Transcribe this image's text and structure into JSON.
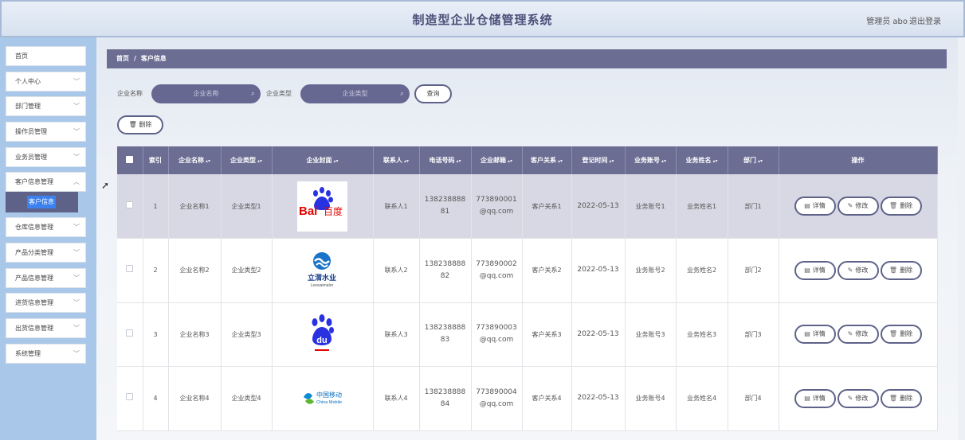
{
  "header": {
    "title": "制造型企业仓储管理系统",
    "admin": "管理员 abo",
    "logout": "退出登录"
  },
  "sidebar": {
    "items": [
      {
        "label": "首页",
        "chevron": false
      },
      {
        "label": "个人中心",
        "chevron": true
      },
      {
        "label": "部门管理",
        "chevron": true
      },
      {
        "label": "操作员管理",
        "chevron": true
      },
      {
        "label": "业务员管理",
        "chevron": true
      },
      {
        "label": "客户信息管理",
        "chevron": true
      },
      {
        "label": "仓库信息管理",
        "chevron": true
      },
      {
        "label": "产品分类管理",
        "chevron": true
      },
      {
        "label": "产品信息管理",
        "chevron": true
      },
      {
        "label": "进货信息管理",
        "chevron": true
      },
      {
        "label": "出货信息管理",
        "chevron": true
      },
      {
        "label": "系统管理",
        "chevron": true
      }
    ],
    "sub_item": "客户信息"
  },
  "breadcrumb": {
    "home": "首页",
    "sep": "/",
    "current": "客户信息"
  },
  "search": {
    "company_label": "企业名称",
    "company_placeholder": "企业名称",
    "type_label": "企业类型",
    "type_placeholder": "企业类型",
    "query_button": "查询",
    "delete_button": "删除"
  },
  "table": {
    "headers": [
      "索引",
      "企业名称",
      "企业类型",
      "企业封面",
      "联系人",
      "电话号码",
      "企业邮箱",
      "客户关系",
      "登记时间",
      "业务账号",
      "业务姓名",
      "部门",
      "操作"
    ],
    "actions": {
      "detail": "详情",
      "edit": "修改",
      "delete": "删除"
    },
    "rows": [
      {
        "index": "1",
        "name": "企业名称1",
        "type": "企业类型1",
        "cover": "baidu-logo",
        "contact": "联系人1",
        "tel_a": "138238888",
        "tel_b": "81",
        "mail_a": "773890001",
        "mail_b": "@qq.com",
        "relation": "客户关系1",
        "date": "2022-05-13",
        "account": "业务账号1",
        "staff": "业务姓名1",
        "dept": "部门1"
      },
      {
        "index": "2",
        "name": "企业名称2",
        "type": "企业类型2",
        "cover": "liwei-logo",
        "contact": "联系人2",
        "tel_a": "138238888",
        "tel_b": "82",
        "mail_a": "773890002",
        "mail_b": "@qq.com",
        "relation": "客户关系2",
        "date": "2022-05-13",
        "account": "业务账号2",
        "staff": "业务姓名2",
        "dept": "部门2"
      },
      {
        "index": "3",
        "name": "企业名称3",
        "type": "企业类型3",
        "cover": "du-paw-logo",
        "contact": "联系人3",
        "tel_a": "138238888",
        "tel_b": "83",
        "mail_a": "773890003",
        "mail_b": "@qq.com",
        "relation": "客户关系3",
        "date": "2022-05-13",
        "account": "业务账号3",
        "staff": "业务姓名3",
        "dept": "部门3"
      },
      {
        "index": "4",
        "name": "企业名称4",
        "type": "企业类型4",
        "cover": "china-mobile-logo",
        "contact": "联系人4",
        "tel_a": "138238888",
        "tel_b": "84",
        "mail_a": "773890004",
        "mail_b": "@qq.com",
        "relation": "客户关系4",
        "date": "2022-05-13",
        "account": "业务账号4",
        "staff": "业务姓名4",
        "dept": "部门4"
      }
    ]
  },
  "logos": {
    "baidu_left": "Bai",
    "baidu_right": "百度",
    "liwei_cn": "立渭水业",
    "liwei_en": "Leewaimater",
    "du": "du",
    "cm_cn": "中国移动",
    "cm_en": "China Mobile"
  },
  "colors": {
    "accent": "#6b6d93",
    "sidebar": "#a9c7e8",
    "active_row": "#d7d8e3"
  }
}
